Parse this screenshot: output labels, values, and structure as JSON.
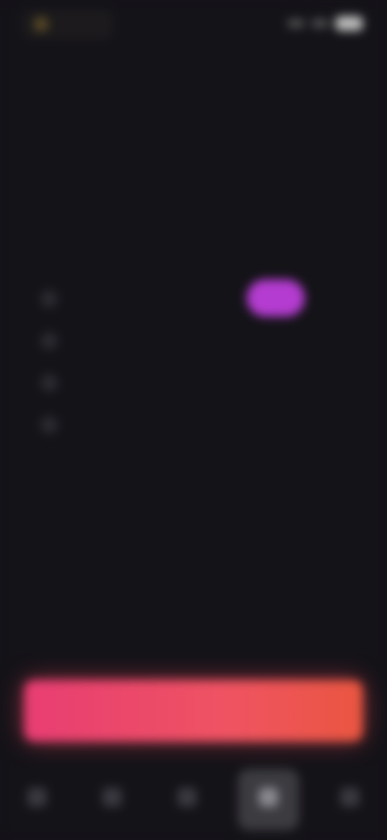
{
  "status_bar": {
    "app_badge": ""
  },
  "header": {
    "title": ""
  },
  "content": {
    "heading": "",
    "steps": [
      {
        "number": "",
        "text": ""
      },
      {
        "number": "",
        "text": ""
      },
      {
        "number": "",
        "text": ""
      },
      {
        "number": "",
        "text": ""
      }
    ]
  },
  "cta": {
    "label": ""
  },
  "bottom_nav": {
    "items": [
      {
        "label": "",
        "icon": "home-icon"
      },
      {
        "label": "",
        "icon": "search-icon"
      },
      {
        "label": "",
        "icon": "list-icon"
      },
      {
        "label": "",
        "icon": "profile-icon",
        "active": true
      },
      {
        "label": "",
        "icon": "menu-icon"
      }
    ]
  },
  "colors": {
    "background": "#141318",
    "accent_start": "#e83d73",
    "accent_end": "#ea5640",
    "highlight": "#b43cd0"
  }
}
